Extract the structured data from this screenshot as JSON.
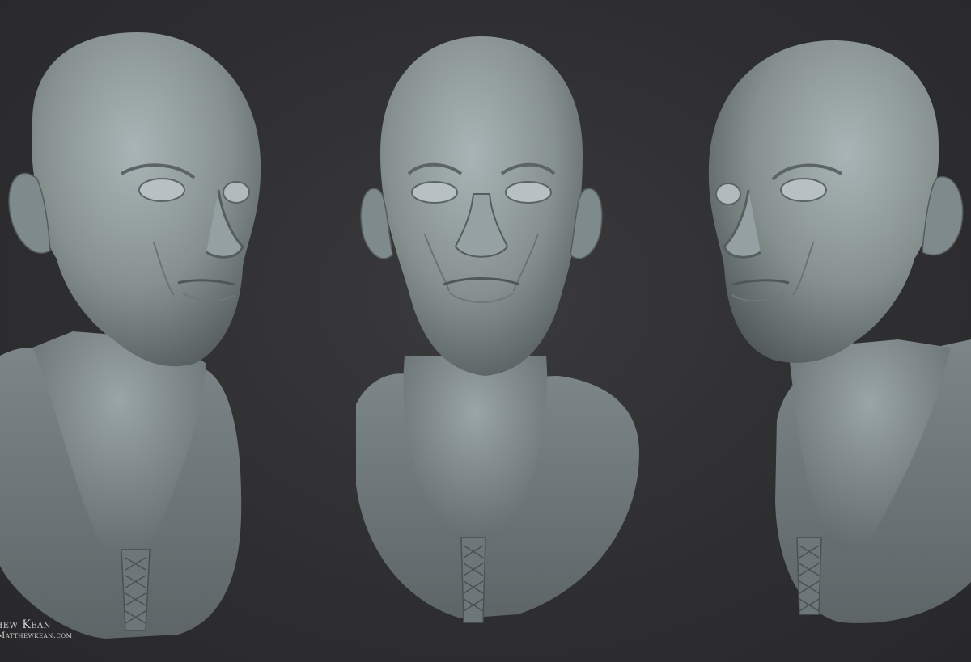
{
  "image": {
    "subject": "three views of a sculpted bald male bust wearing a laced tunic",
    "background_color": "#2e2e30",
    "clay_color": "#8f9a9c",
    "views": [
      {
        "id": "three-quarter-left",
        "label": ""
      },
      {
        "id": "front",
        "label": ""
      },
      {
        "id": "three-quarter-right",
        "label": ""
      }
    ]
  },
  "credit": {
    "name": "tthew Kean",
    "url": "Matthewkean.com"
  }
}
